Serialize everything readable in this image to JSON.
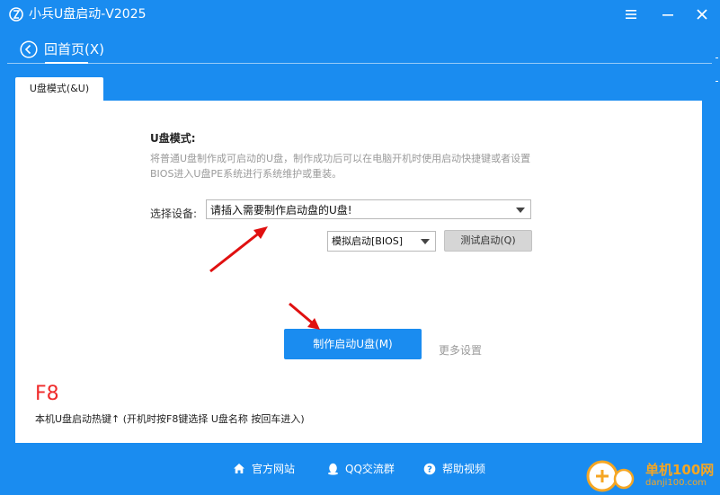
{
  "app": {
    "title": "小兵U盘启动-V2025"
  },
  "nav": {
    "back_label": "回首页(X)"
  },
  "tabs": [
    {
      "label": "U盘模式(&U)"
    }
  ],
  "mode": {
    "title": "U盘模式:",
    "description": "将普通U盘制作成可启动的U盘，制作成功后可以在电脑开机时使用启动快捷键或者设置BIOS进入U盘PE系统进行系统维护或重装。"
  },
  "device": {
    "label": "选择设备:",
    "value": "请插入需要制作启动盘的U盘!"
  },
  "simulate": {
    "value": "模拟启动[BIOS]"
  },
  "buttons": {
    "test": "测试启动(Q)",
    "make": "制作启动U盘(M)",
    "more": "更多设置"
  },
  "hotkey": {
    "key": "F8",
    "description": "本机U盘启动热键↑ (开机时按F8键选择 U盘名称 按回车进入)"
  },
  "footer": {
    "links": [
      {
        "label": "官方网站",
        "icon": "home-icon"
      },
      {
        "label": "QQ交流群",
        "icon": "qq-icon"
      },
      {
        "label": "帮助视频",
        "icon": "help-icon"
      }
    ]
  },
  "watermark": {
    "line1": "单机100网",
    "line2": "danji100.com"
  },
  "colors": {
    "brand_blue": "#1a8cf0",
    "hotkey_red": "#ef2b2b",
    "arrow_red": "#e01010"
  }
}
